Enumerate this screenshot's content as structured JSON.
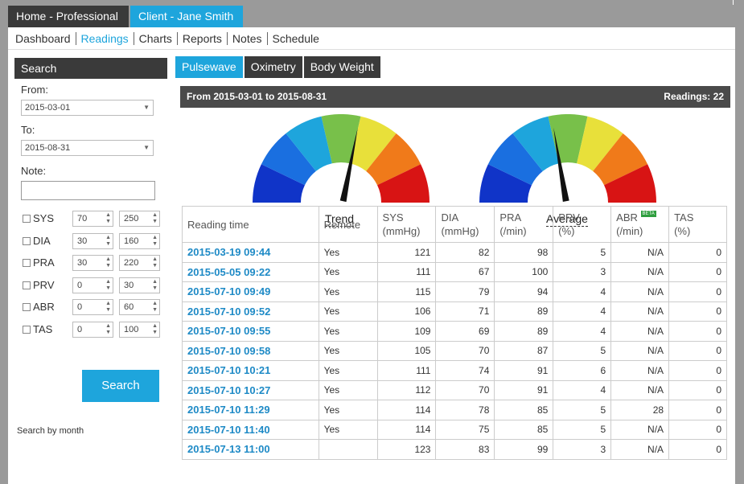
{
  "top_tabs": {
    "home": "Home - Professional",
    "client": "Client - Jane Smith"
  },
  "subnav": [
    "Dashboard",
    "Readings",
    "Charts",
    "Reports",
    "Notes",
    "Schedule"
  ],
  "sidebar": {
    "title": "Search",
    "from_label": "From:",
    "from_value": "2015-03-01",
    "to_label": "To:",
    "to_value": "2015-08-31",
    "note_label": "Note:",
    "filters": [
      {
        "name": "SYS",
        "min": "70",
        "max": "250"
      },
      {
        "name": "DIA",
        "min": "30",
        "max": "160"
      },
      {
        "name": "PRA",
        "min": "30",
        "max": "220"
      },
      {
        "name": "PRV",
        "min": "0",
        "max": "30"
      },
      {
        "name": "ABR",
        "min": "0",
        "max": "60"
      },
      {
        "name": "TAS",
        "min": "0",
        "max": "100"
      }
    ],
    "search_button": "Search",
    "month_link": "Search by month"
  },
  "tabs": [
    "Pulsewave",
    "Oximetry",
    "Body Weight"
  ],
  "range": {
    "text": "From 2015-03-01 to 2015-08-31",
    "count": "Readings: 22"
  },
  "gauges": {
    "trend": {
      "label": "Trend",
      "needle_fraction": 0.57
    },
    "average": {
      "label": "Average",
      "needle_fraction": 0.44
    },
    "colors": [
      "#1034c8",
      "#1a6fe0",
      "#1ea5dc",
      "#78c04a",
      "#e8e03a",
      "#f07a1a",
      "#d81414"
    ]
  },
  "table": {
    "headers": [
      {
        "l1": "Reading time",
        "l2": ""
      },
      {
        "l1": "Remote",
        "l2": ""
      },
      {
        "l1": "SYS",
        "l2": "(mmHg)"
      },
      {
        "l1": "DIA",
        "l2": "(mmHg)"
      },
      {
        "l1": "PRA",
        "l2": "(/min)"
      },
      {
        "l1": "PRV",
        "l2": "(%)"
      },
      {
        "l1": "ABR",
        "l2": "(/min)",
        "badge": "BETA"
      },
      {
        "l1": "TAS",
        "l2": "(%)"
      }
    ],
    "rows": [
      [
        "2015-03-19 09:44",
        "Yes",
        "121",
        "82",
        "98",
        "5",
        "N/A",
        "0"
      ],
      [
        "2015-05-05 09:22",
        "Yes",
        "111",
        "67",
        "100",
        "3",
        "N/A",
        "0"
      ],
      [
        "2015-07-10 09:49",
        "Yes",
        "115",
        "79",
        "94",
        "4",
        "N/A",
        "0"
      ],
      [
        "2015-07-10 09:52",
        "Yes",
        "106",
        "71",
        "89",
        "4",
        "N/A",
        "0"
      ],
      [
        "2015-07-10 09:55",
        "Yes",
        "109",
        "69",
        "89",
        "4",
        "N/A",
        "0"
      ],
      [
        "2015-07-10 09:58",
        "Yes",
        "105",
        "70",
        "87",
        "5",
        "N/A",
        "0"
      ],
      [
        "2015-07-10 10:21",
        "Yes",
        "111",
        "74",
        "91",
        "6",
        "N/A",
        "0"
      ],
      [
        "2015-07-10 10:27",
        "Yes",
        "112",
        "70",
        "91",
        "4",
        "N/A",
        "0"
      ],
      [
        "2015-07-10 11:29",
        "Yes",
        "114",
        "78",
        "85",
        "5",
        "28",
        "0"
      ],
      [
        "2015-07-10 11:40",
        "Yes",
        "114",
        "75",
        "85",
        "5",
        "N/A",
        "0"
      ],
      [
        "2015-07-13 11:00",
        "",
        "123",
        "83",
        "99",
        "3",
        "N/A",
        "0"
      ]
    ]
  }
}
